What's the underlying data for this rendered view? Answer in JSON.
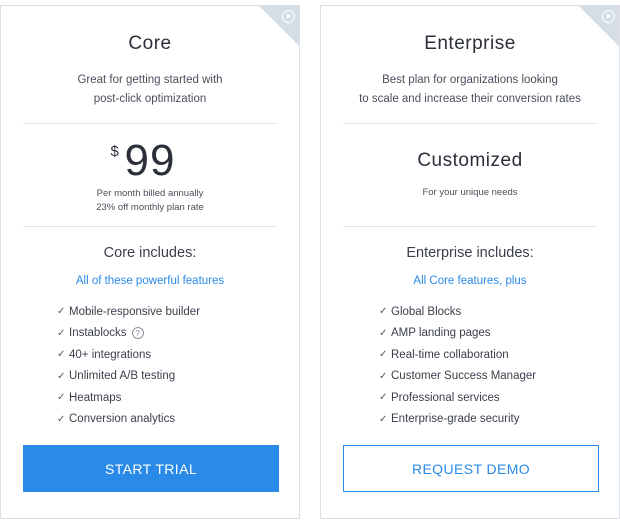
{
  "colors": {
    "accent": "#2a8ae8",
    "border": "#dcdfe4",
    "text": "#2b2f3a",
    "corner": "#d5dde6"
  },
  "core": {
    "title": "Core",
    "description_lines": [
      "Great for getting started with",
      "post-click optimization"
    ],
    "price": {
      "currency": "$",
      "amount": "99",
      "notes": [
        "Per month billed annually",
        "23% off monthly plan rate"
      ]
    },
    "includes_label": "Core includes:",
    "highlight": "All of these powerful features",
    "features": [
      "Mobile-responsive builder",
      "Instablocks",
      "40+ integrations",
      "Unlimited A/B testing",
      "Heatmaps",
      "Conversion analytics"
    ],
    "feature_help_icon": "?",
    "cta": "START TRIAL",
    "corner_icon": "play-icon"
  },
  "enterprise": {
    "title": "Enterprise",
    "description_lines": [
      "Best plan for organizations looking",
      "to scale and increase their conversion rates"
    ],
    "price_label": "Customized",
    "price_note": "For your unique needs",
    "includes_label": "Enterprise includes:",
    "highlight": "All Core features, plus",
    "features": [
      "Global Blocks",
      "AMP landing pages",
      "Real-time collaboration",
      "Customer Success Manager",
      "Professional services",
      "Enterprise-grade security"
    ],
    "cta": "REQUEST DEMO",
    "corner_icon": "play-icon"
  },
  "check_glyph": "✓"
}
